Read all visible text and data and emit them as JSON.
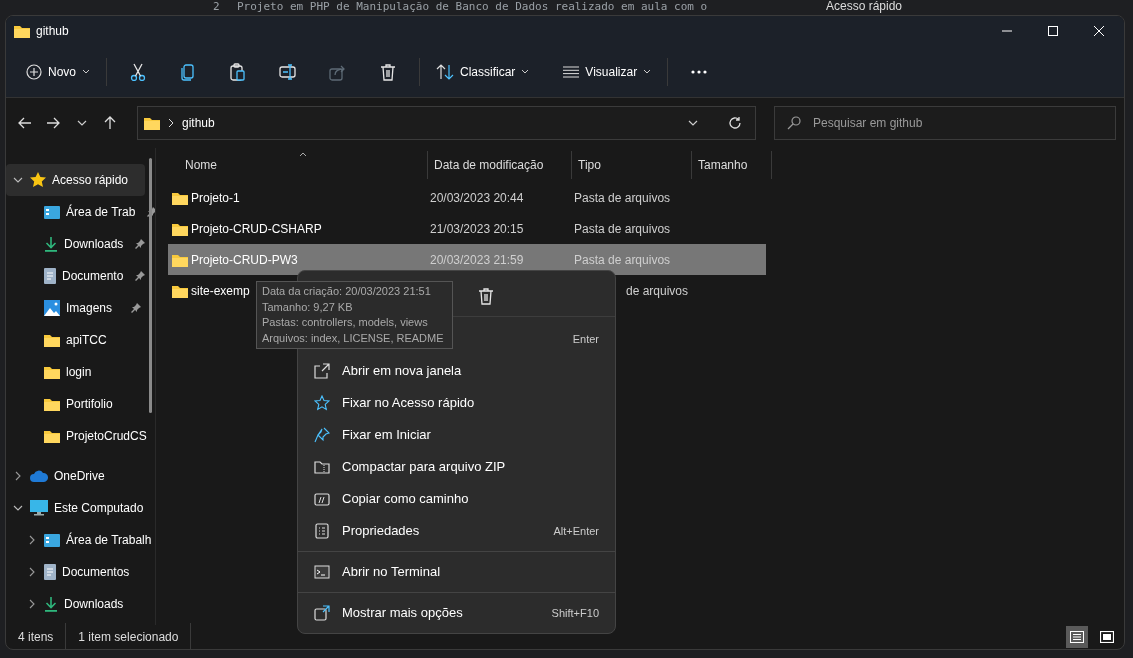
{
  "background": {
    "editor_line_number": "2",
    "editor_line": "Projeto em PHP de Manipulação de Banco de Dados realizado em aula com o",
    "other_window_item": "Acesso rápido"
  },
  "window": {
    "title": "github"
  },
  "toolbar": {
    "new_button": "Novo",
    "sort_button": "Classificar",
    "view_button": "Visualizar",
    "actions": [
      {
        "kind": "cut",
        "disabled": false
      },
      {
        "kind": "copy",
        "disabled": false
      },
      {
        "kind": "paste",
        "disabled": false
      },
      {
        "kind": "rename",
        "disabled": false
      },
      {
        "kind": "share",
        "disabled": true
      },
      {
        "kind": "delete",
        "disabled": false
      }
    ]
  },
  "address": {
    "crumbs": [
      "github"
    ]
  },
  "search": {
    "placeholder": "Pesquisar em github"
  },
  "sidebar": {
    "items": [
      {
        "label": "Acesso rápido",
        "kind": "star",
        "expanded": true,
        "selected": true,
        "children": [
          {
            "label": "Área de Trab",
            "kind": "desktop",
            "pinned": true,
            "selected": false
          },
          {
            "label": "Downloads",
            "kind": "download",
            "pinned": true,
            "selected": false
          },
          {
            "label": "Documento",
            "kind": "document",
            "pinned": true,
            "selected": false
          },
          {
            "label": "Imagens",
            "kind": "image",
            "pinned": true,
            "selected": false
          },
          {
            "label": "apiTCC",
            "kind": "folder",
            "pinned": false,
            "selected": false
          },
          {
            "label": "login",
            "kind": "folder",
            "pinned": false,
            "selected": false
          },
          {
            "label": "Portifolio",
            "kind": "folder",
            "pinned": false,
            "selected": false
          },
          {
            "label": "ProjetoCrudCS",
            "kind": "folder",
            "pinned": false,
            "selected": false
          }
        ]
      },
      {
        "label": "OneDrive",
        "kind": "cloud",
        "expanded": false,
        "selected": false
      },
      {
        "label": "Este Computado",
        "kind": "computer",
        "expanded": true,
        "selected": false,
        "children": [
          {
            "label": "Área de Trabalh",
            "kind": "desktop",
            "expanded": false,
            "selected": false
          },
          {
            "label": "Documentos",
            "kind": "document",
            "expanded": false,
            "selected": false
          },
          {
            "label": "Downloads",
            "kind": "download",
            "expanded": false,
            "selected": false
          }
        ]
      }
    ]
  },
  "table": {
    "columns": [
      "Nome",
      "Data de modificação",
      "Tipo",
      "Tamanho"
    ],
    "rows": [
      {
        "name": "Projeto-1",
        "modified": "20/03/2023 20:44",
        "type": "Pasta de arquivos",
        "selected": false
      },
      {
        "name": "Projeto-CRUD-CSHARP",
        "modified": "21/03/2023 20:15",
        "type": "Pasta de arquivos",
        "selected": false
      },
      {
        "name": "Projeto-CRUD-PW3",
        "modified": "20/03/2023 21:59",
        "type": "Pasta de arquivos",
        "selected": true
      },
      {
        "name": "site-exemp",
        "modified": "",
        "type": "de arquivos",
        "selected": false
      }
    ]
  },
  "tooltip": {
    "lines": [
      "Data da criação: 20/03/2023 21:51",
      "Tamanho: 9,27 KB",
      "Pastas: controllers, models, views",
      "Arquivos: index, LICENSE, README"
    ]
  },
  "context_menu": {
    "quick_actions": [
      {
        "kind": "delete"
      }
    ],
    "items": [
      {
        "kind": "open",
        "shortcut": "Enter"
      },
      {
        "kind": "newwindow",
        "label": "Abrir em nova janela"
      },
      {
        "kind": "star",
        "label": "Fixar no Acesso rápido"
      },
      {
        "kind": "pin",
        "label": "Fixar em Iniciar"
      },
      {
        "kind": "zip",
        "label": "Compactar para arquivo ZIP"
      },
      {
        "kind": "path",
        "label": "Copiar como caminho"
      },
      {
        "kind": "props",
        "label": "Propriedades",
        "shortcut": "Alt+Enter"
      },
      {
        "kind": "separator"
      },
      {
        "kind": "terminal",
        "label": "Abrir no Terminal"
      },
      {
        "kind": "separator"
      },
      {
        "kind": "more",
        "label": "Mostrar mais opções",
        "shortcut": "Shift+F10"
      }
    ]
  },
  "status_bar": {
    "item_count": "4 itens",
    "selection": "1 item selecionado",
    "views": [
      {
        "kind": "details",
        "selected": true
      },
      {
        "kind": "tiles",
        "selected": false
      }
    ]
  }
}
